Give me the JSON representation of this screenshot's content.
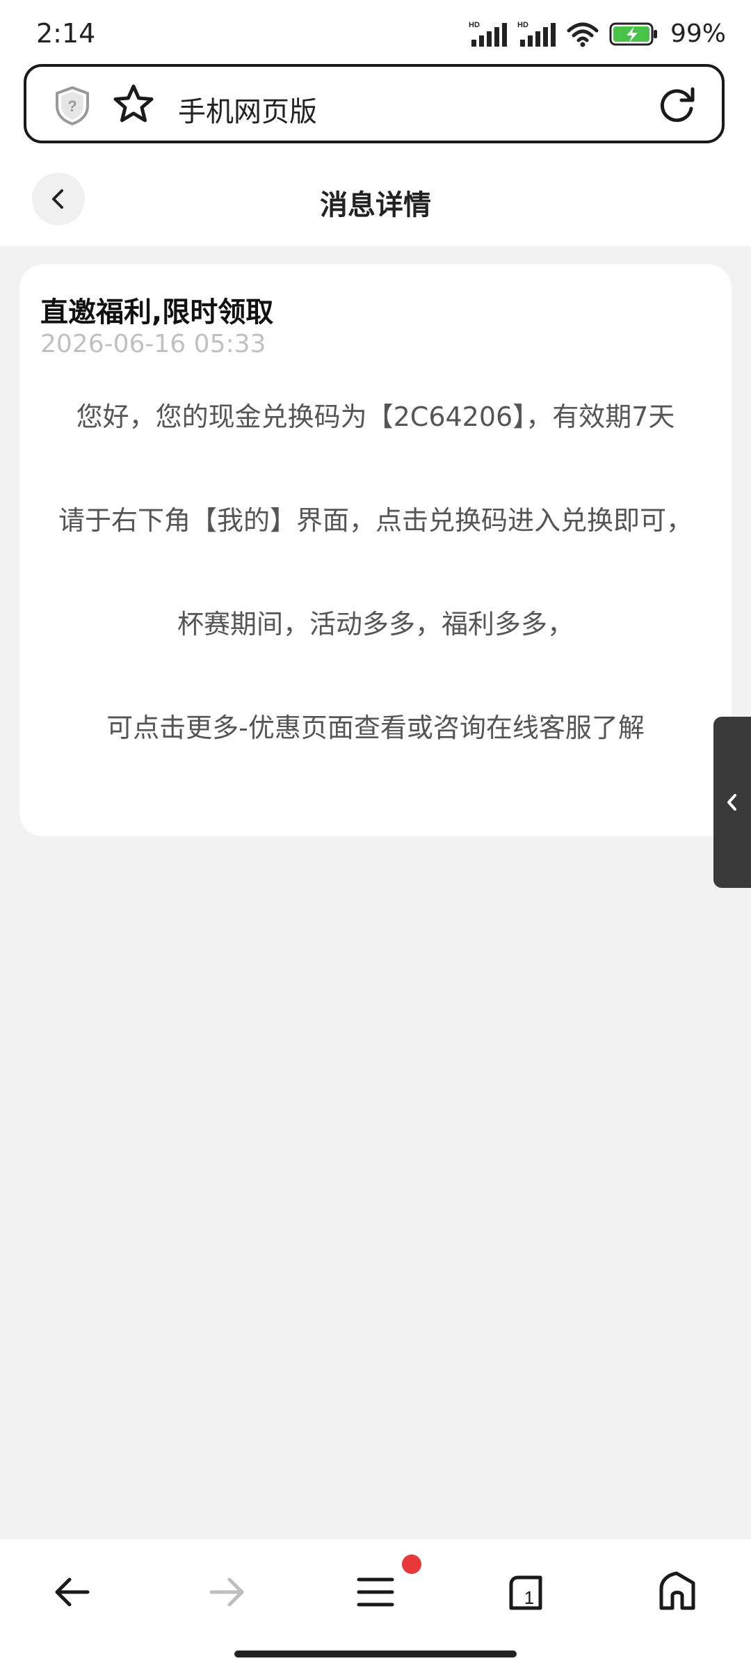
{
  "status_bar": {
    "time": "2:14",
    "battery_percent": "99%",
    "signal1_label": "HD",
    "signal2_label": "HD",
    "icons": [
      "signal-hd-icon",
      "signal-hd-icon",
      "wifi-icon",
      "battery-charging-icon"
    ]
  },
  "browser": {
    "url_text": "手机网页版",
    "icons": [
      "shield-question-icon",
      "star-icon",
      "reload-icon"
    ]
  },
  "header": {
    "title": "消息详情",
    "back_icon": "chevron-left-icon"
  },
  "message": {
    "title": "直邀福利,限时领取",
    "time": "2026-06-16 05:33",
    "paragraphs": [
      "您好，您的现金兑换码为【2C64206】，有效期7天",
      "请于右下角【我的】界面，点击兑换码进入兑换即可，",
      "杯赛期间，活动多多，福利多多，",
      "可点击更多-优惠页面查看或咨询在线客服了解"
    ]
  },
  "side_tab": {
    "icon": "chevron-left-icon"
  },
  "bottom_nav": {
    "items": [
      "back-arrow-icon",
      "forward-arrow-icon",
      "menu-icon",
      "tabs-icon",
      "home-icon"
    ],
    "tabs_count": "1",
    "accent_badge_color": "#e8393a"
  }
}
